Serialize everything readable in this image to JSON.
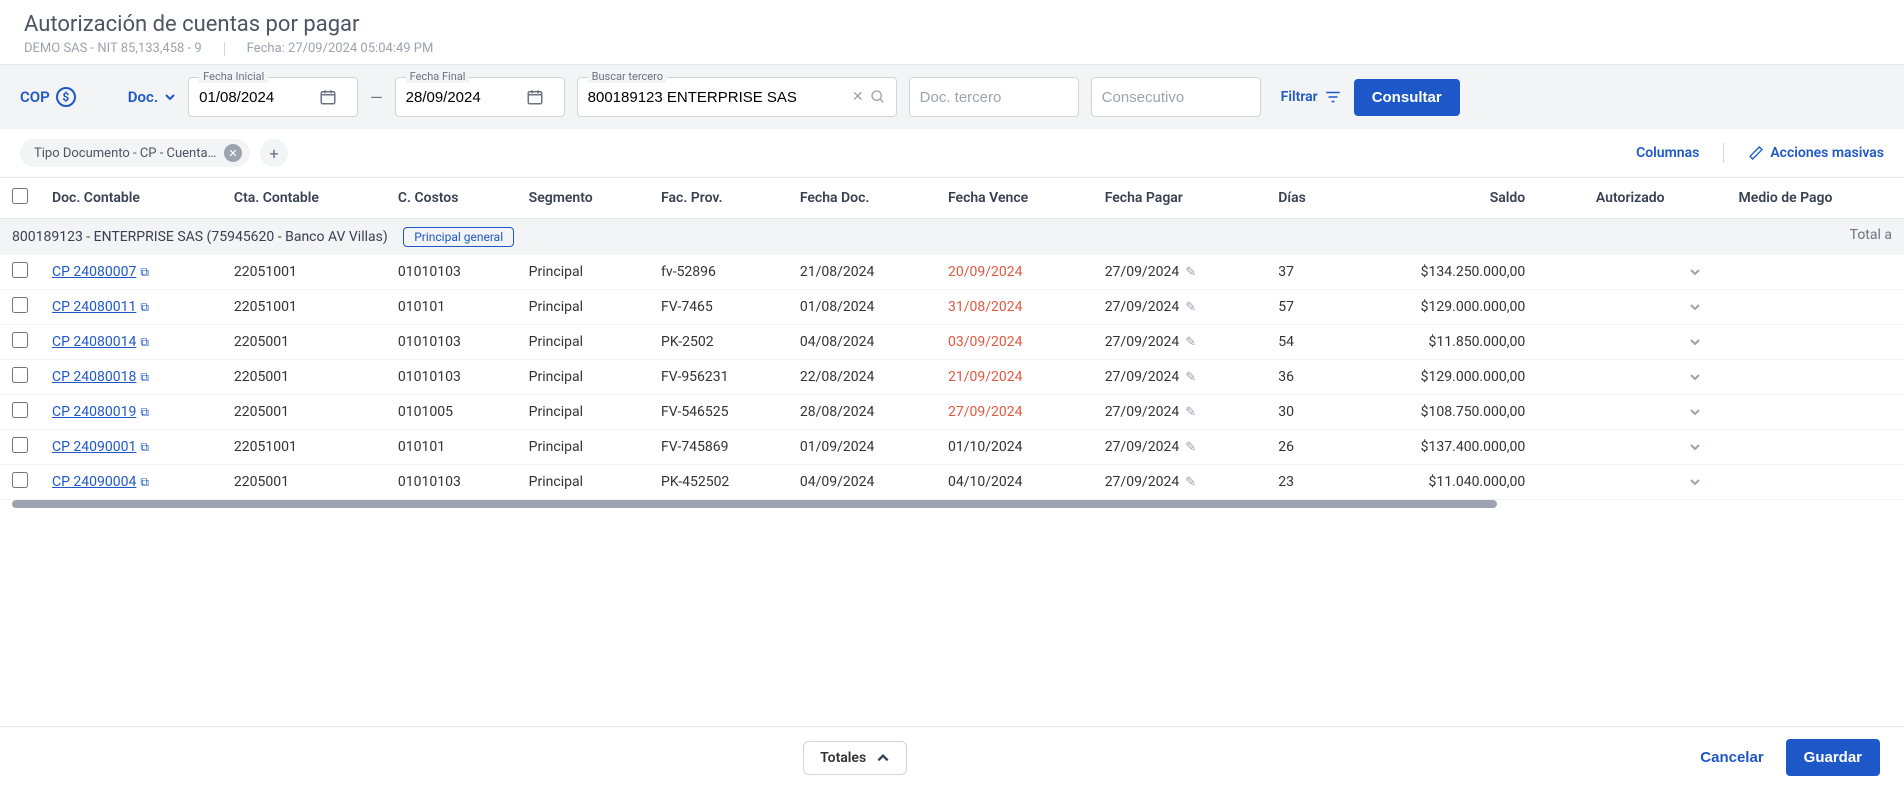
{
  "header": {
    "title": "Autorización de cuentas por pagar",
    "company": "DEMO SAS - NIT 85,133,458 - 9",
    "date_label": "Fecha: 27/09/2024 05:04:49 PM"
  },
  "filters": {
    "currency": "COP",
    "doc_label": "Doc.",
    "fecha_inicial_label": "Fecha Inicial",
    "fecha_inicial": "01/08/2024",
    "fecha_final_label": "Fecha Final",
    "fecha_final": "28/09/2024",
    "buscar_tercero_label": "Buscar tercero",
    "buscar_tercero": "800189123 ENTERPRISE SAS",
    "doc_tercero_placeholder": "Doc. tercero",
    "consecutivo_placeholder": "Consecutivo",
    "filtrar": "Filtrar",
    "consultar": "Consultar"
  },
  "chips": {
    "tipo_doc": "Tipo Documento - CP - Cuenta ...",
    "columnas": "Columnas",
    "acciones_masivas": "Acciones masivas"
  },
  "table": {
    "headers": {
      "doc_contable": "Doc. Contable",
      "cta_contable": "Cta. Contable",
      "c_costos": "C. Costos",
      "segmento": "Segmento",
      "fac_prov": "Fac. Prov.",
      "fecha_doc": "Fecha Doc.",
      "fecha_vence": "Fecha Vence",
      "fecha_pagar": "Fecha Pagar",
      "dias": "Días",
      "saldo": "Saldo",
      "autorizado": "Autorizado",
      "medio_pago": "Medio de Pago"
    },
    "group": {
      "label": "800189123 - ENTERPRISE SAS (75945620 - Banco AV Villas)",
      "badge": "Principal general",
      "total_label": "Total a"
    },
    "rows": [
      {
        "doc": "CP 24080007",
        "cta": "22051001",
        "cc": "01010103",
        "seg": "Principal",
        "fac": "fv-52896",
        "fdoc": "21/08/2024",
        "fven": "20/09/2024",
        "overdue": true,
        "fpag": "27/09/2024",
        "dias": "37",
        "saldo": "$134.250.000,00"
      },
      {
        "doc": "CP 24080011",
        "cta": "22051001",
        "cc": "010101",
        "seg": "Principal",
        "fac": "FV-7465",
        "fdoc": "01/08/2024",
        "fven": "31/08/2024",
        "overdue": true,
        "fpag": "27/09/2024",
        "dias": "57",
        "saldo": "$129.000.000,00"
      },
      {
        "doc": "CP 24080014",
        "cta": "2205001",
        "cc": "01010103",
        "seg": "Principal",
        "fac": "PK-2502",
        "fdoc": "04/08/2024",
        "fven": "03/09/2024",
        "overdue": true,
        "fpag": "27/09/2024",
        "dias": "54",
        "saldo": "$11.850.000,00"
      },
      {
        "doc": "CP 24080018",
        "cta": "2205001",
        "cc": "01010103",
        "seg": "Principal",
        "fac": "FV-956231",
        "fdoc": "22/08/2024",
        "fven": "21/09/2024",
        "overdue": true,
        "fpag": "27/09/2024",
        "dias": "36",
        "saldo": "$129.000.000,00"
      },
      {
        "doc": "CP 24080019",
        "cta": "2205001",
        "cc": "0101005",
        "seg": "Principal",
        "fac": "FV-546525",
        "fdoc": "28/08/2024",
        "fven": "27/09/2024",
        "overdue": true,
        "fpag": "27/09/2024",
        "dias": "30",
        "saldo": "$108.750.000,00"
      },
      {
        "doc": "CP 24090001",
        "cta": "22051001",
        "cc": "010101",
        "seg": "Principal",
        "fac": "FV-745869",
        "fdoc": "01/09/2024",
        "fven": "01/10/2024",
        "overdue": false,
        "fpag": "27/09/2024",
        "dias": "26",
        "saldo": "$137.400.000,00"
      },
      {
        "doc": "CP 24090004",
        "cta": "2205001",
        "cc": "01010103",
        "seg": "Principal",
        "fac": "PK-452502",
        "fdoc": "04/09/2024",
        "fven": "04/10/2024",
        "overdue": false,
        "fpag": "27/09/2024",
        "dias": "23",
        "saldo": "$11.040.000,00"
      }
    ]
  },
  "footer": {
    "totales": "Totales",
    "cancelar": "Cancelar",
    "guardar": "Guardar"
  }
}
